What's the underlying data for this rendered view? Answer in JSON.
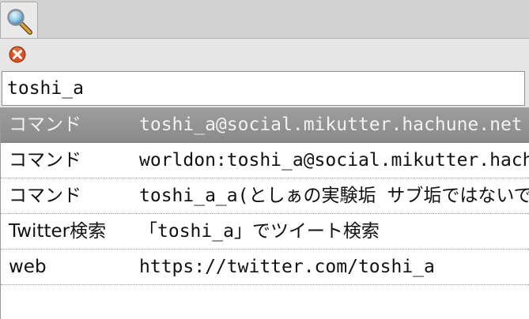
{
  "tab": {
    "icon": "magnifier-icon"
  },
  "toolbar": {
    "close_icon": "close-icon"
  },
  "search": {
    "value": "toshi_a"
  },
  "results": [
    {
      "type": "コマンド",
      "desc": "toshi_a@social.mikutter.hachune.net",
      "selected": true
    },
    {
      "type": "コマンド",
      "desc": "worldon:toshi_a@social.mikutter.hachune.net"
    },
    {
      "type": "コマンド",
      "desc": "toshi_a_a(としぁの実験垢 サブ垢ではないです)"
    },
    {
      "type": "Twitter検索",
      "desc": "「toshi_a」でツイート検索"
    },
    {
      "type": "web",
      "desc": "https://twitter.com/toshi_a"
    }
  ],
  "colors": {
    "selected_row": "#939393",
    "close_icon": "#d5511f"
  }
}
